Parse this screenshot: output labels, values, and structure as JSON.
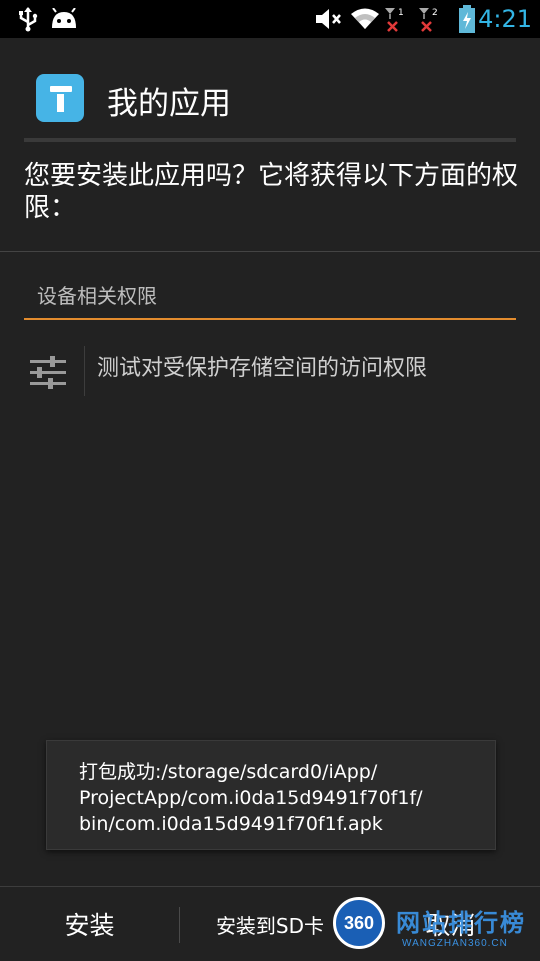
{
  "status_bar": {
    "time": "4:21",
    "icons": [
      "usb-icon",
      "android-icon",
      "mute-icon",
      "wifi-icon",
      "signal-1-icon",
      "signal-2-icon",
      "battery-charging-icon"
    ],
    "sim1": "1",
    "sim2": "2",
    "accent": "#33b5e5"
  },
  "header": {
    "app_name": "我的应用",
    "icon_color": "#46b4e6"
  },
  "prompt": {
    "question": "您要安装此应用吗？它将获得以下方面的权限："
  },
  "permissions": {
    "section_title": "设备相关权限",
    "accent": "#e38c2e",
    "items": [
      {
        "icon": "settings-sliders-icon",
        "label": "测试对受保护存储空间的访问权限"
      }
    ]
  },
  "toast": {
    "message": "打包成功:/storage/sdcard0/iApp/\nProjectApp/com.i0da15d9491f70f1f/\nbin/com.i0da15d9491f70f1f.apk"
  },
  "buttons": {
    "install": "安装",
    "install_sd": "安装到SD卡",
    "cancel": "取消"
  },
  "watermark": {
    "logo": "360",
    "name": "网站排行榜",
    "site": "WANGZHAN360.CN",
    "color": "#3a90e0"
  }
}
